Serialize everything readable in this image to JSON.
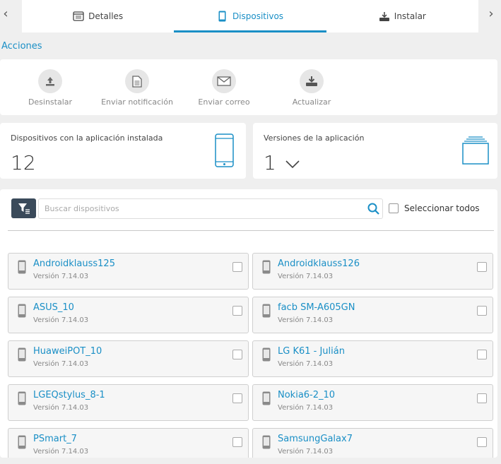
{
  "tabs": [
    {
      "label": "Detalles",
      "icon": "details-icon"
    },
    {
      "label": "Dispositivos",
      "icon": "phone-icon",
      "active": true
    },
    {
      "label": "Instalar",
      "icon": "install-icon"
    }
  ],
  "actions": {
    "title": "Acciones",
    "items": [
      {
        "label": "Desinstalar",
        "icon": "uninstall-icon"
      },
      {
        "label": "Enviar notificación",
        "icon": "document-icon"
      },
      {
        "label": "Enviar correo",
        "icon": "mail-icon"
      },
      {
        "label": "Actualizar",
        "icon": "update-icon"
      }
    ]
  },
  "stats": {
    "installed": {
      "title": "Dispositivos con la aplicación instalada",
      "value": "12"
    },
    "versions": {
      "title": "Versiones de la aplicación",
      "value": "1"
    }
  },
  "search": {
    "placeholder": "Buscar dispositivos"
  },
  "select_all_label": "Seleccionar todos",
  "devices": [
    {
      "name": "Androidklauss125",
      "version": "Versión 7.14.03"
    },
    {
      "name": "Androidklauss126",
      "version": "Versión 7.14.03"
    },
    {
      "name": "ASUS_10",
      "version": "Versión 7.14.03"
    },
    {
      "name": "facb SM-A605GN",
      "version": "Versión 7.14.03"
    },
    {
      "name": "HuaweiPOT_10",
      "version": "Versión 7.14.03"
    },
    {
      "name": "LG K61 - Julián",
      "version": "Versión 7.14.03"
    },
    {
      "name": "LGEQstylus_8-1",
      "version": "Versión 7.14.03"
    },
    {
      "name": "Nokia6-2_10",
      "version": "Versión 7.14.03"
    },
    {
      "name": "PSmart_7",
      "version": "Versión 7.14.03"
    },
    {
      "name": "SamsungGalax7",
      "version": "Versión 7.14.03"
    }
  ],
  "colors": {
    "accent": "#1a8fc6",
    "filter_button": "#3a4a5a"
  }
}
